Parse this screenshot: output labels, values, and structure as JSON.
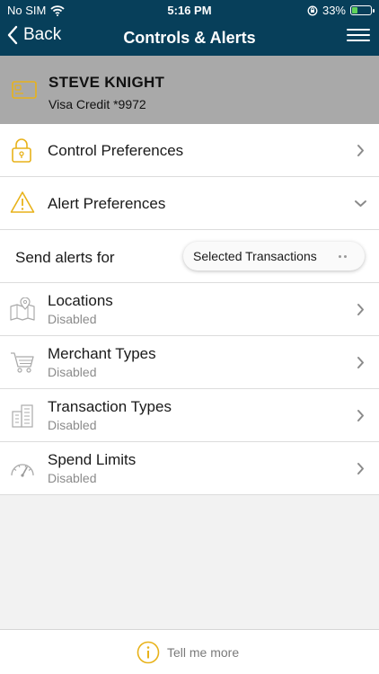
{
  "status_bar": {
    "carrier": "No SIM",
    "time": "5:16 PM",
    "battery": "33%",
    "battery_level": 0.33
  },
  "nav": {
    "back_label": "Back",
    "title": "Controls & Alerts"
  },
  "card": {
    "holder_name": "STEVE KNIGHT",
    "card_label": "Visa Credit *9972"
  },
  "preferences": [
    {
      "label": "Control Preferences",
      "icon": "lock-icon",
      "expanded": false
    },
    {
      "label": "Alert Preferences",
      "icon": "warning-icon",
      "expanded": true
    }
  ],
  "send_alerts": {
    "label": "Send alerts for",
    "selected": "Selected Transactions"
  },
  "alert_items": [
    {
      "label": "Locations",
      "status": "Disabled",
      "icon": "map-pin-icon"
    },
    {
      "label": "Merchant Types",
      "status": "Disabled",
      "icon": "shopping-cart-icon"
    },
    {
      "label": "Transaction Types",
      "status": "Disabled",
      "icon": "buildings-icon"
    },
    {
      "label": "Spend Limits",
      "status": "Disabled",
      "icon": "speedometer-icon"
    }
  ],
  "footer": {
    "tell_more": "Tell me more"
  },
  "colors": {
    "nav_bg": "#073f5a",
    "accent": "#e8b21a",
    "header_gray": "#a9a9a9",
    "muted_text": "#8b8b8b"
  }
}
